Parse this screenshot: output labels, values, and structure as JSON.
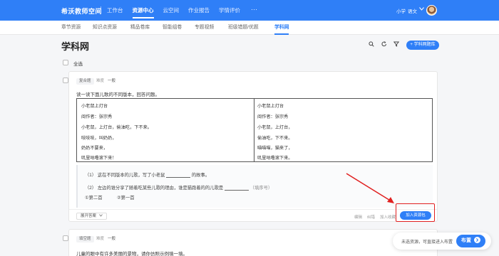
{
  "header": {
    "logo": "希沃教师空间",
    "nav": [
      "工作台",
      "资源中心",
      "云空间",
      "作业报告",
      "学情评价"
    ],
    "more": "···",
    "grade": "小学",
    "subject": "语文",
    "subject_chevron": "chevron-down-icon"
  },
  "subnav": [
    "章节资源",
    "知识点资源",
    "精品卷库",
    "智能组卷",
    "专题视频",
    "班级错题/优题",
    "学科网"
  ],
  "page": {
    "title": "学科网",
    "add_button": "+ 学科网题库",
    "select_all": "全选"
  },
  "question1": {
    "type": "复合题",
    "difficulty_label": "难度",
    "difficulty": "一般",
    "instruction": "读一读下面儿歌的不同版本，回答问题。",
    "left_lines": [
      "小老鼠上灯台",
      "阅作者：张宗秀",
      "小老鼠，上灯台，偷油吃，下不来。",
      "吱吱吱，叫奶奶，",
      "奶奶不要来，",
      "叽里咕噜滚下来！"
    ],
    "right_lines": [
      "小老鼠上灯台",
      "阅作者：张宗秀",
      "小老鼠，上灯台，",
      "偷油吃，下不来。",
      "喵喵喵，猫来了，",
      "叽里咕噜滚下来。"
    ],
    "sub_q1": "（1）  这在不同版本的儿歌，写了小老鼠",
    "sub_q1_after": "的故事。",
    "sub_q2": "（2）  左边的谁分享了随着吃某些儿歌的理由，谁是猫跑着的的儿歌是",
    "sub_q2_hint": "（填序号）",
    "opt1": "①第二首",
    "opt2": "②第一首",
    "expand_btn": "展开答案",
    "links": [
      "编辑",
      "纠错",
      "加入收藏"
    ],
    "join_btn": "加入资源包"
  },
  "question2": {
    "type": "填空题",
    "difficulty_label": "难度",
    "difficulty": "一般",
    "text": "儿童的眼中有许多美丽的景物，请你仿照示例填一填。"
  },
  "toast": {
    "text": "未选资源，可直接进入布置",
    "button": "布置",
    "button_icon": "arrow-right-icon"
  },
  "colors": {
    "brand": "#2f7ff7",
    "highlight": "#e02020"
  }
}
